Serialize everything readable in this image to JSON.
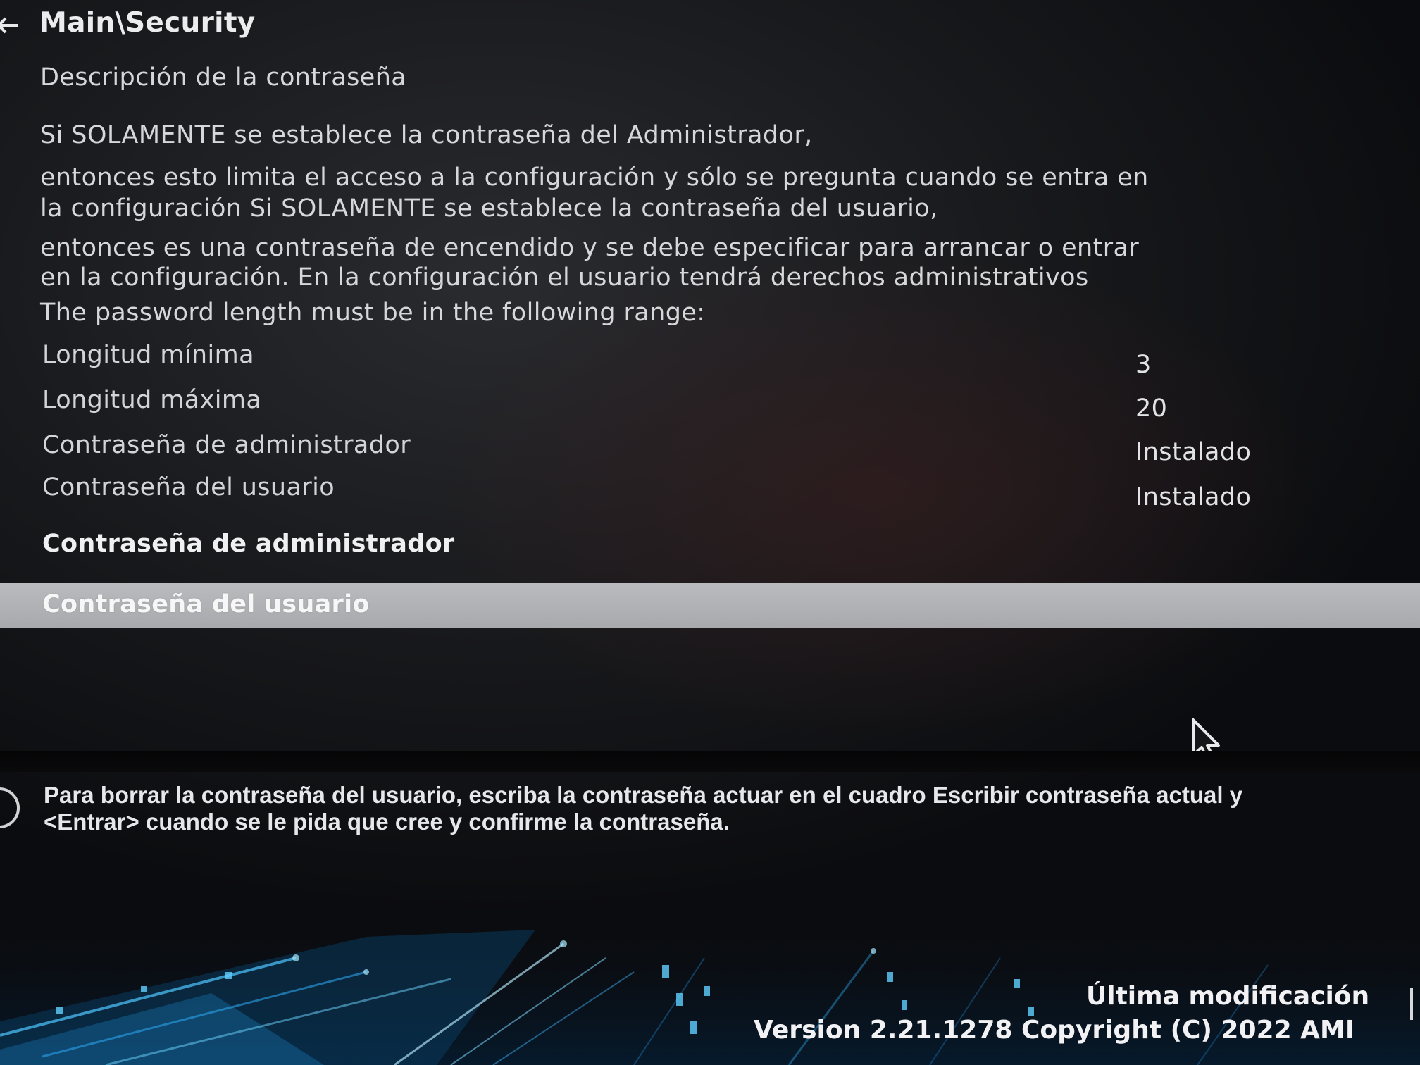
{
  "breadcrumb": "Main\\Security",
  "description": {
    "heading": "Descripción de la contraseña",
    "lines": [
      "Si SOLAMENTE se establece la contraseña del Administrador,",
      "entonces esto limita el acceso a la configuración y sólo se pregunta cuando se entra en",
      "la configuración Si SOLAMENTE se establece la contraseña del usuario,",
      "entonces es una contraseña de encendido y se debe especificar para arrancar o entrar",
      "en la configuración. En la configuración el usuario tendrá derechos administrativos",
      "The password length must be in the following range:"
    ]
  },
  "settings": [
    {
      "label": "Longitud mínima",
      "value": "3"
    },
    {
      "label": "Longitud máxima",
      "value": "20"
    },
    {
      "label": "Contraseña de administrador",
      "value": "Instalado"
    },
    {
      "label": "Contraseña del usuario",
      "value": "Instalado"
    }
  ],
  "menu": {
    "admin_password": "Contraseña de administrador",
    "user_password": "Contraseña del usuario",
    "selected": "user_password"
  },
  "help": {
    "line1": "Para borrar la contraseña del usuario, escriba la contraseña actuar en el cuadro Escribir contraseña actual y",
    "line2": "<Entrar> cuando se le pida que cree y confirme la contraseña."
  },
  "footer": {
    "last_modified": "Última modificación",
    "version": "Version 2.21.1278 Copyright (C) 2022 AMI"
  },
  "colors": {
    "background": "#18191c",
    "highlight": "#b1b3b7",
    "text": "#d9dadd",
    "accent": "#1fa4e8"
  },
  "icons": {
    "back": "arrow-left-icon",
    "help": "help-circle-icon",
    "cursor": "mouse-pointer-icon"
  }
}
